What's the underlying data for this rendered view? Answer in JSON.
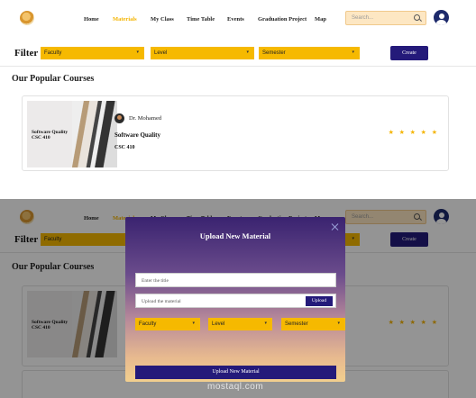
{
  "nav": {
    "items": [
      "Home",
      "Materials",
      "My Class",
      "Time Table",
      "Events",
      "Graduation Project",
      "Map"
    ],
    "active": "Materials",
    "search_placeholder": "Search..."
  },
  "filter": {
    "label": "Filter",
    "selects": [
      "Faculty",
      "Level",
      "Semester"
    ],
    "create_label": "Create"
  },
  "section_title": "Our Popular Courses",
  "course": {
    "thumb_title": "Software Quality",
    "thumb_code": "CSC 410",
    "instructor": "Dr. Mohamed",
    "name": "Software Quality",
    "code": "CSC 410",
    "stars": "★ ★ ★ ★ ★"
  },
  "modal": {
    "title": "Upload New Material",
    "title_placeholder": "Enter the title",
    "upload_field_label": "Upload the material",
    "upload_button": "Upload",
    "selects": [
      "Faculty",
      "Level",
      "Semester"
    ],
    "submit_label": "Upload New Material"
  },
  "watermark": "mostaql.com",
  "colors": {
    "accent_yellow": "#f6b900",
    "primary_navy": "#241a7a",
    "active_nav": "#f4b400"
  }
}
